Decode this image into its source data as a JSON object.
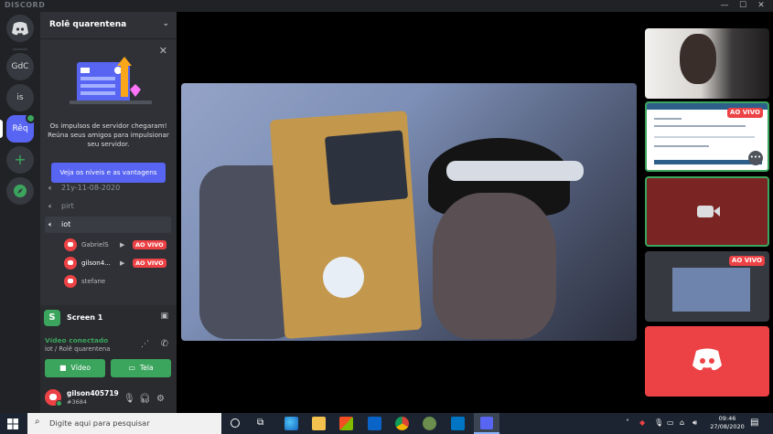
{
  "titlebar": {
    "brand": "DISCORD",
    "minimize": "—",
    "maximize": "☐",
    "close": "✕"
  },
  "guilds": [
    {
      "label": "GdC"
    },
    {
      "label": "is"
    },
    {
      "label": "Rêq"
    },
    {
      "label": "+"
    }
  ],
  "server": {
    "name": "Rolê quarentena",
    "boost_text": "Os impulsos de servidor chegaram! Reúna seus amigos para impulsionar seu servidor.",
    "boost_button": "Veja os níveis e as vantagens"
  },
  "channels": [
    {
      "name": "21y-11-08-2020"
    },
    {
      "name": "pirt"
    },
    {
      "name": "iot"
    }
  ],
  "voice_users": [
    {
      "name": "GabrielS",
      "live": "AO VIVO"
    },
    {
      "name": "gilson4...",
      "live": "AO VIVO"
    },
    {
      "name": "stefane"
    }
  ],
  "screen_panel": {
    "avatar_letter": "S",
    "title": "Screen 1",
    "status": "Vídeo conectado",
    "location": "iot / Rolê quarentena",
    "video_button": "Vídeo",
    "screen_button": "Tela"
  },
  "user": {
    "name": "gilson405719",
    "tag": "#3684"
  },
  "tiles": [
    {
      "kind": "camera"
    },
    {
      "kind": "screen",
      "live": "AO VIVO"
    },
    {
      "kind": "camera-off"
    },
    {
      "kind": "screen",
      "live": "AO VIVO"
    },
    {
      "kind": "discord"
    }
  ],
  "taskbar": {
    "search_placeholder": "Digite aqui para pesquisar",
    "time": "09:46",
    "date": "27/08/2020"
  },
  "colors": {
    "accent": "#5865f2",
    "live": "#ed4245",
    "online": "#3ba55d"
  }
}
